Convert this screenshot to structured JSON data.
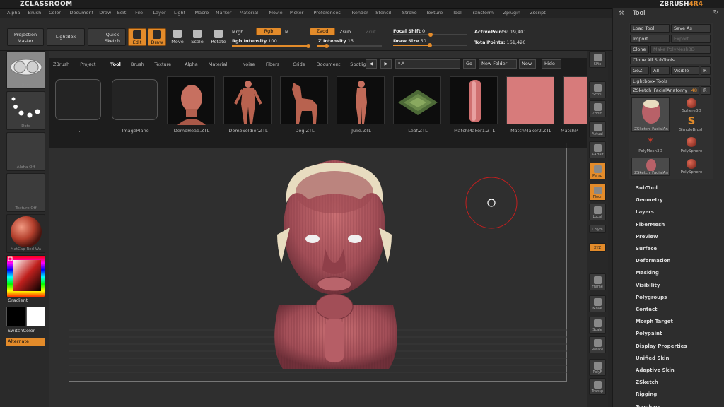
{
  "app": {
    "title": "ZCLASSROOM",
    "brand": "ZBRUSH",
    "version": "4R4"
  },
  "menu": [
    "Alpha",
    "Brush",
    "Color",
    "Document",
    "Draw",
    "Edit",
    "File",
    "Layer",
    "Light",
    "Macro",
    "Marker",
    "Material",
    "Movie",
    "Picker",
    "Preferences",
    "Render",
    "Stencil",
    "Stroke",
    "Texture",
    "Tool",
    "Transform",
    "Zplugin",
    "Zscript"
  ],
  "toolbar": {
    "projection_master": "Projection Master",
    "lightbox": "LightBox",
    "quick_sketch": "Quick Sketch",
    "edit": "Edit",
    "draw": "Draw",
    "move": "Move",
    "scale": "Scale",
    "rotate": "Rotate",
    "mrgb": "Mrgb",
    "rgb": "Rgb",
    "m": "M",
    "rgb_intensity_label": "Rgb Intensity",
    "rgb_intensity_value": "100",
    "rgb_intensity_fraction": 1.0,
    "zadd": "Zadd",
    "zsub": "Zsub",
    "zcut": "Zcut",
    "z_intensity_label": "Z Intensity",
    "z_intensity_value": "15",
    "z_intensity_fraction": 0.15,
    "focal_shift_label": "Focal Shift",
    "focal_shift_value": "0",
    "draw_size_label": "Draw Size",
    "draw_size_value": "50",
    "draw_size_fraction": 0.5,
    "active_points_label": "ActivePoints:",
    "active_points_value": "19,401",
    "total_points_label": "TotalPoints:",
    "total_points_value": "161,426"
  },
  "left_shelf": {
    "brush": "Dots",
    "stroke": "Dots",
    "alpha": "Alpha Off",
    "texture": "Texture Off",
    "material": "MatCap Red Wa",
    "gradient": "Gradient",
    "switch_color": "SwitchColor",
    "alternate": "Alternate"
  },
  "lightbox": {
    "tabs": [
      "ZBrush",
      "Project",
      "Tool",
      "Brush",
      "Texture",
      "Alpha",
      "Material",
      "Noise",
      "Fibers",
      "Grids",
      "Document",
      "Spotlight"
    ],
    "active_tab": "Tool",
    "search_value": "*.*",
    "go": "Go",
    "new_folder": "New Folder",
    "new": "New",
    "hide": "Hide",
    "items": [
      "..",
      "ImagePlane",
      "DemoHead.ZTL",
      "DemoSoldier.ZTL",
      "Dog.ZTL",
      "Julie.ZTL",
      "Leaf.ZTL",
      "MatchMaker1.ZTL",
      "MatchMaker2.ZTL",
      "MatchM"
    ]
  },
  "right_shelf": [
    "SPix",
    "Scroll",
    "Zoom",
    "Actual",
    "AAHalf",
    "Persp",
    "Floor",
    "Local",
    "L.Sym",
    "XYZ",
    "Frame",
    "Move",
    "Scale",
    "Rotate",
    "PolyF",
    "Transp"
  ],
  "tool_palette": {
    "title": "Tool",
    "load_tool": "Load Tool",
    "save_as": "Save As",
    "import": "Import",
    "export": "Export",
    "clone": "Clone",
    "make_polymesh": "Make PolyMesh3D",
    "clone_all": "Clone All SubTools",
    "goz": "GoZ",
    "all": "All",
    "visible": "Visible",
    "r": "R",
    "lightbox_tools": "Lightbox▸ Tools",
    "current_tool": "ZSketch_FacialAnatomy",
    "current_tool_value": "48",
    "tools": [
      "ZSketch_FacialAn",
      "Sphere3D",
      "SimpleBrush",
      "PolyMesh3D",
      "PolySphere",
      "ZSketch_FacialAn",
      "PolySphere"
    ],
    "sections": [
      "SubTool",
      "Geometry",
      "Layers",
      "FiberMesh",
      "Preview",
      "Surface",
      "Deformation",
      "Masking",
      "Visibility",
      "Polygroups",
      "Contact",
      "Morph Target",
      "Polypaint",
      "Display Properties",
      "Unified Skin",
      "Adaptive Skin",
      "ZSketch",
      "Rigging",
      "Topology"
    ]
  },
  "colors": {
    "accent": "#e38b2a",
    "skin": "#b86168",
    "skull": "#e8dcc0"
  }
}
